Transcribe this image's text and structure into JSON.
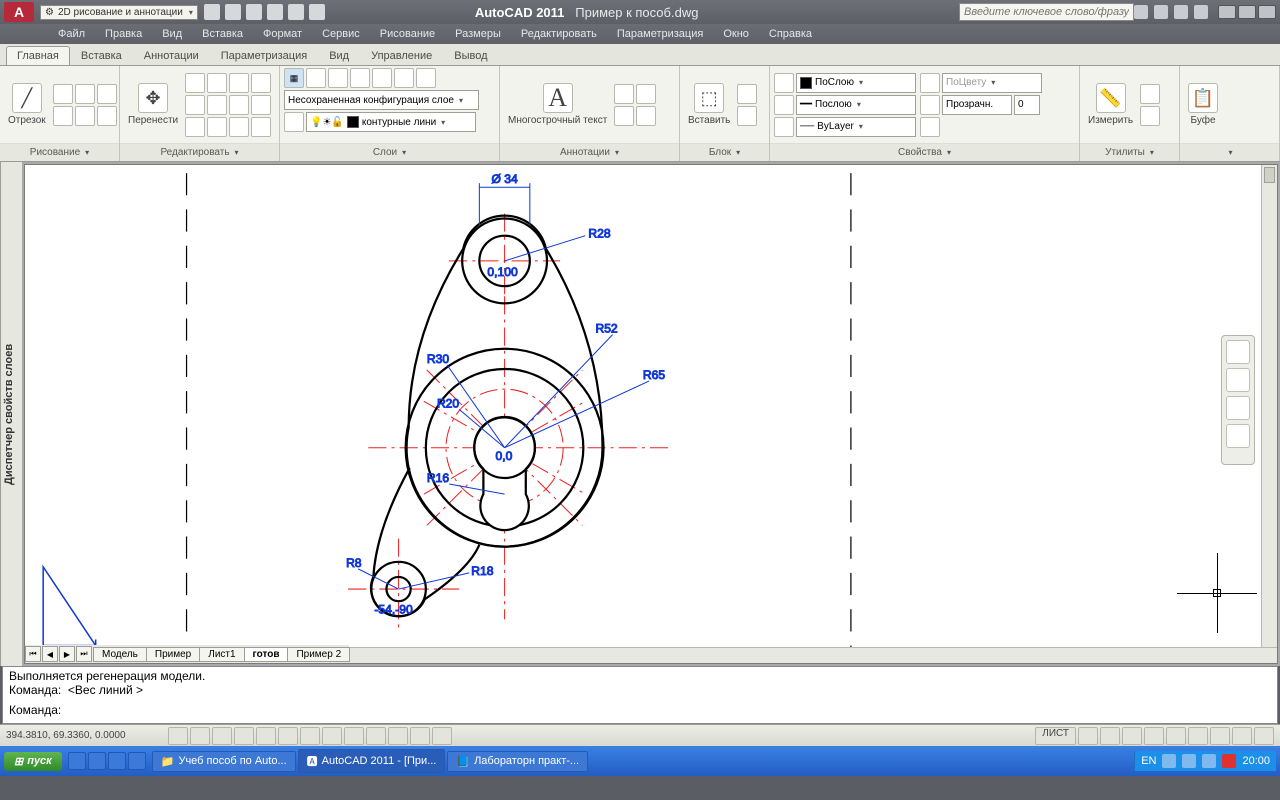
{
  "title": {
    "app": "AutoCAD 2011",
    "file": "Пример к пособ.dwg"
  },
  "workspace": "2D рисование и аннотации",
  "search_placeholder": "Введите ключевое слово/фразу",
  "menu": [
    "Файл",
    "Правка",
    "Вид",
    "Вставка",
    "Формат",
    "Сервис",
    "Рисование",
    "Размеры",
    "Редактировать",
    "Параметризация",
    "Окно",
    "Справка"
  ],
  "ribbon_tabs": [
    "Главная",
    "Вставка",
    "Аннотации",
    "Параметризация",
    "Вид",
    "Управление",
    "Вывод"
  ],
  "panels": {
    "draw": {
      "label": "Рисование",
      "big": "Отрезок"
    },
    "modify": {
      "label": "Редактировать",
      "big": "Перенести"
    },
    "layers": {
      "label": "Слои",
      "config": "Несохраненная конфигурация слое",
      "current": "контурные лини"
    },
    "annot": {
      "label": "Аннотации",
      "big": "Многострочный текст"
    },
    "block": {
      "label": "Блок",
      "big": "Вставить"
    },
    "props": {
      "label": "Свойства",
      "color": "ПоСлою",
      "ltype": "ByLayer",
      "lweight": "Послою",
      "bycolor": "ПоЦвету",
      "trans": "Прозрачн.",
      "trans_val": "0"
    },
    "util": {
      "label": "Утилиты",
      "big": "Измерить"
    },
    "clip": {
      "label": "Буфе"
    }
  },
  "side_panel": "Диспетчер свойств слоев",
  "layout_tabs": [
    "Модель",
    "Пример",
    "Лист1",
    "готов",
    "Пример 2"
  ],
  "layout_active": 3,
  "cmd": {
    "line1": "Выполняется регенерация модели.",
    "line2": "Команда:  <Вес линий >",
    "prompt": "Команда:"
  },
  "status": {
    "coords": "394.3810, 69.3360, 0.0000",
    "sheet": "ЛИСТ"
  },
  "dims": {
    "d34": "Ø 34",
    "r28": "R28",
    "c0100": "0,100",
    "r52": "R52",
    "r65": "R65",
    "r30": "R30",
    "r20": "R20",
    "r16": "R16",
    "c00": "0,0",
    "r8": "R8",
    "r18": "R18",
    "c5490": "-54,-90"
  },
  "taskbar": {
    "start": "пуск",
    "tasks": [
      "Учеб пособ по Auto...",
      "AutoCAD 2011 - [При...",
      "Лабораторн практ-..."
    ],
    "lang": "EN",
    "time": "20:00"
  }
}
